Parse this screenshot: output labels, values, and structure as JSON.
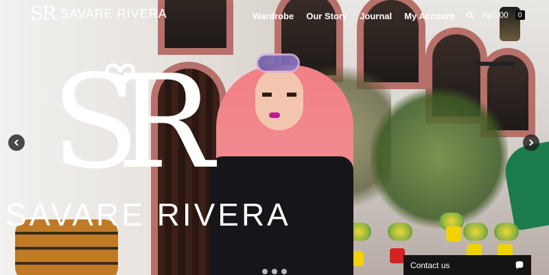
{
  "brand": {
    "monogram": "SR",
    "name": "SAVARE RIVERA"
  },
  "nav": [
    {
      "label": "Wardrobe"
    },
    {
      "label": "Our Story"
    },
    {
      "label": "Journal"
    },
    {
      "label": "My Account"
    }
  ],
  "tools": {
    "search_icon": "search-icon",
    "cart_amount": "Rp0,00",
    "cart_count": "0"
  },
  "hero": {
    "logo_monogram": "SR",
    "wordmark": "SAVARE RIVERA",
    "prev_icon": "chevron-left-icon",
    "next_icon": "chevron-right-icon",
    "dots": [
      "",
      "",
      ""
    ]
  },
  "contact": {
    "label": "Contact us",
    "icon": "chat-icon"
  },
  "colors": {
    "hijab_pink": "#f08a8f",
    "header_text": "#ffffff",
    "dark_bar": "#141414"
  }
}
